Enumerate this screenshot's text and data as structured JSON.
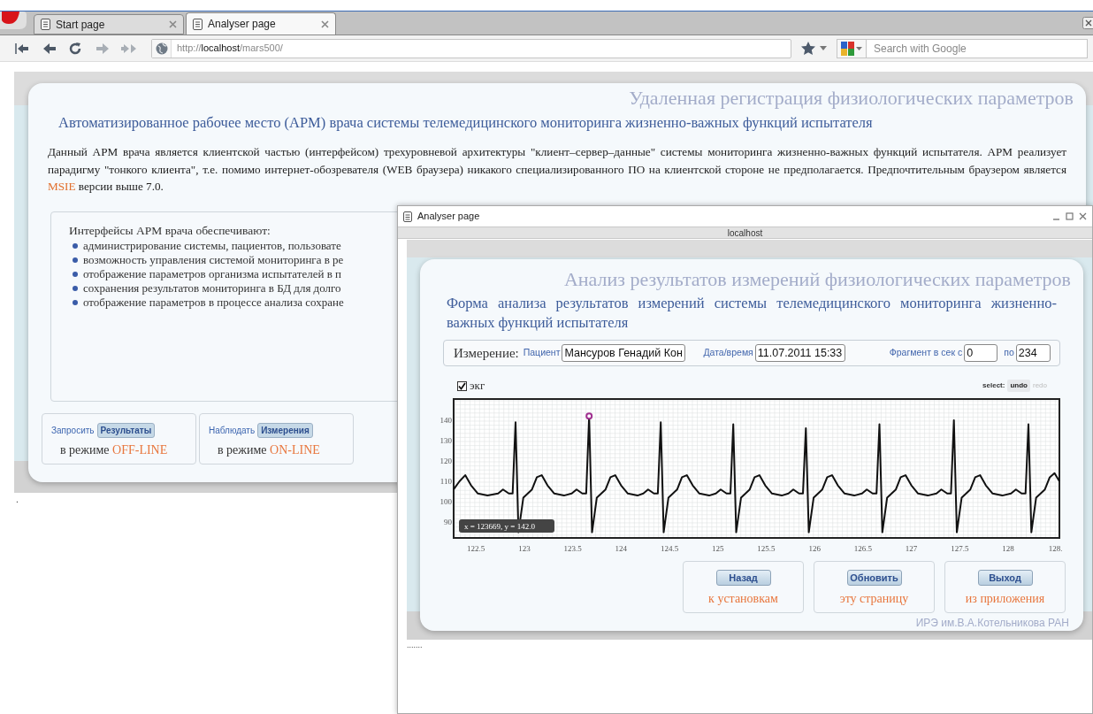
{
  "browser": {
    "tabs": [
      {
        "label": "Start page",
        "selected": false
      },
      {
        "label": "Analyser page",
        "selected": true
      }
    ],
    "address": {
      "scheme": "http://",
      "host": "localhost",
      "path": "/mars500/"
    },
    "search": {
      "placeholder": "Search with Google"
    }
  },
  "page": {
    "banner": "Удаленная регистрация физиологических параметров",
    "title": "Автоматизированное рабочее место (АРМ) врача системы телемедицинского мониторинга жизненно-важных функций испытателя",
    "intro": {
      "before": "Данный АРМ врача является клиентской частью (интерфейсом) трехуровневой архитектуры \"клиент–сервер–данные\" системы мониторинга жизненно-важных функций испытателя. АРМ реализует парадигму \"тонкого клиента\", т.е. помимо интернет-обозревателя (WEB браузера) никакого специализированного ПО на клиентской стороне не предполагается. Предпочтительным браузером является ",
      "highlight": "MSIE",
      "after": " версии выше 7.0."
    },
    "features": {
      "heading": "Интерфейсы АРМ врача обеспечивают:",
      "items": [
        "администрирование системы, пациентов, пользовате",
        "возможность управления системой мониторинга в ре",
        "отображение параметров организма испытателей в п",
        "сохранения результатов мониторинга в БД для долго",
        "отображение параметров в процессе анализа сохране"
      ]
    },
    "actions": [
      {
        "label": "Запросить",
        "button": "Результаты",
        "prefix": "в режиме",
        "mode": "OFF-LINE"
      },
      {
        "label": "Наблюдать",
        "button": "Измерения",
        "prefix": "в режиме",
        "mode": "ON-LINE"
      }
    ],
    "status": "."
  },
  "popup": {
    "title": "Analyser page",
    "host": "localhost",
    "banner": "Анализ результатов измерений физиологических параметров",
    "title2": "Форма анализа результатов измерений системы телемедицинского мониторинга жизненно-важных функций испытателя",
    "measurement": {
      "label": "Измерение:",
      "patient_label": "Пациент",
      "patient": "Мансуров Генадий Кон",
      "datetime_label": "Дата/время",
      "datetime": "11.07.2011 15:33",
      "fragment_label": "Фрагмент в сек с",
      "from": "0",
      "to_label": "по",
      "to": "234"
    },
    "signal": {
      "checked": true
    },
    "select": {
      "label": "select:",
      "options": [
        {
          "label": "undo",
          "disabled": false
        },
        {
          "label": "redo",
          "disabled": true
        }
      ]
    },
    "chart": {
      "tooltip": "x = 123669, y = 142.0",
      "chart_data": {
        "type": "line",
        "grid": true,
        "xlim": [
          122.27,
          128.53
        ],
        "ylim": [
          82.2,
          150.4
        ],
        "xticks": [
          122.5,
          123,
          123.5,
          124,
          124.5,
          125,
          125.5,
          126,
          126.5,
          127,
          127.5,
          128,
          {
            "value": 128.5,
            "label": "128."
          }
        ],
        "yticks": [
          90,
          100,
          110,
          120,
          130,
          140
        ],
        "x": [
          122.27,
          122.33,
          122.39,
          122.45,
          122.52,
          122.62,
          122.73,
          122.78,
          122.84,
          122.88,
          122.91,
          122.94,
          122.99,
          123.08,
          123.13,
          123.18,
          123.24,
          123.31,
          123.41,
          123.49,
          123.54,
          123.6,
          123.64,
          123.67,
          123.7,
          123.75,
          123.84,
          123.89,
          123.94,
          124.0,
          124.07,
          124.17,
          124.23,
          124.28,
          124.34,
          124.38,
          124.41,
          124.44,
          124.49,
          124.58,
          124.63,
          124.68,
          124.74,
          124.81,
          124.91,
          124.98,
          125.03,
          125.09,
          125.13,
          125.16,
          125.19,
          125.24,
          125.33,
          125.38,
          125.43,
          125.49,
          125.56,
          125.66,
          125.73,
          125.78,
          125.84,
          125.88,
          125.91,
          125.94,
          125.99,
          126.08,
          126.13,
          126.18,
          126.24,
          126.31,
          126.41,
          126.49,
          126.54,
          126.6,
          126.64,
          126.67,
          126.7,
          126.75,
          126.84,
          126.89,
          126.94,
          127.0,
          127.07,
          127.17,
          127.26,
          127.31,
          127.37,
          127.41,
          127.44,
          127.47,
          127.52,
          127.61,
          127.66,
          127.71,
          127.77,
          127.84,
          127.94,
          128.03,
          128.08,
          128.14,
          128.18,
          128.21,
          128.24,
          128.29,
          128.38,
          128.43,
          128.48,
          128.53
        ],
        "series": [
          {
            "name": "экг",
            "color": "#111111",
            "values": [
              106,
              110,
              113,
              108,
              104,
              103,
              104,
              106,
              104,
              104,
              139,
              85,
              102,
              106,
              112,
              113,
              108,
              104,
              103,
              104,
              106,
              104,
              104,
              142,
              85,
              102,
              106,
              112,
              113,
              108,
              104,
              103,
              104,
              106,
              104,
              104,
              139,
              85,
              102,
              106,
              112,
              113,
              108,
              104,
              103,
              104,
              106,
              104,
              104,
              138,
              85,
              102,
              106,
              112,
              113,
              108,
              104,
              103,
              104,
              106,
              104,
              104,
              136,
              85,
              102,
              106,
              112,
              113,
              108,
              104,
              103,
              104,
              106,
              104,
              104,
              138,
              85,
              102,
              106,
              112,
              113,
              108,
              104,
              103,
              104,
              106,
              104,
              104,
              140,
              85,
              102,
              106,
              112,
              113,
              108,
              104,
              103,
              104,
              106,
              104,
              104,
              138,
              85,
              102,
              106,
              112,
              114,
              110
            ]
          }
        ]
      }
    },
    "buttons": [
      {
        "label": "Назад",
        "caption": "к установкам"
      },
      {
        "label": "Обновить",
        "caption": "эту страницу"
      },
      {
        "label": "Выход",
        "caption": "из приложения"
      }
    ],
    "credit": "ИРЭ им.В.А.Котельникова РАН",
    "status": "......."
  }
}
